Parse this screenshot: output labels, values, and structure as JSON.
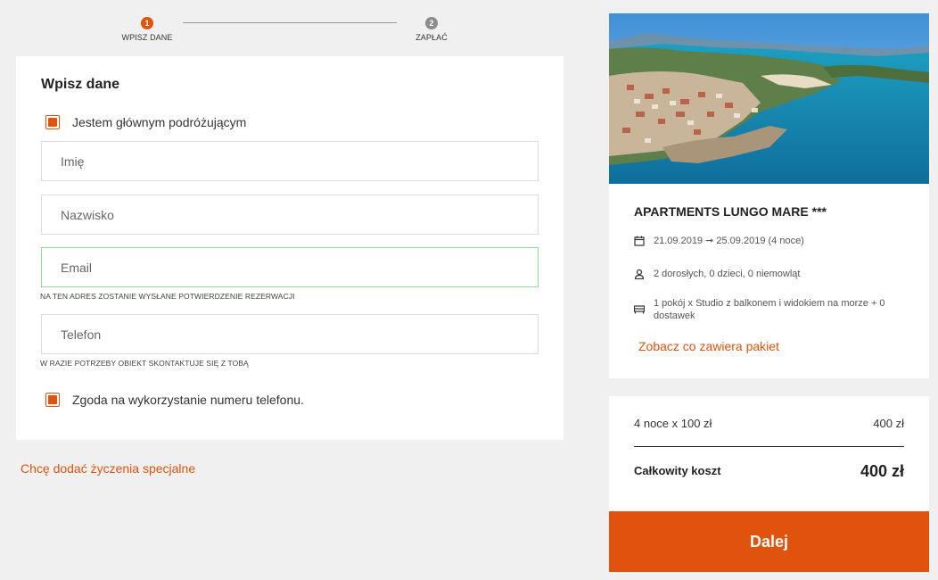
{
  "colors": {
    "accent": "#e0530c",
    "step_active": "#e0530c",
    "step_inactive": "#8c8c8c",
    "focus_border": "#9ad89a",
    "background": "#f0f0f0"
  },
  "stepper": {
    "steps": [
      {
        "number": "1",
        "label": "WPISZ DANE",
        "active": true
      },
      {
        "number": "2",
        "label": "ZAPŁAĆ",
        "active": false
      }
    ]
  },
  "form": {
    "title": "Wpisz dane",
    "main_traveler_label": "Jestem głównym podróżującym",
    "main_traveler_checked": true,
    "first_name": {
      "placeholder": "Imię",
      "value": ""
    },
    "last_name": {
      "placeholder": "Nazwisko",
      "value": ""
    },
    "email": {
      "placeholder": "Email",
      "value": "",
      "hint": "NA TEN ADRES ZOSTANIE WYSŁANE POTWIERDZENIE REZERWACJI"
    },
    "phone": {
      "placeholder": "Telefon",
      "value": "",
      "hint": "W RAZIE POTRZEBY OBIEKT SKONTAKTUJE SIĘ Z TOBĄ"
    },
    "phone_consent_label": "Zgoda na wykorzystanie numeru telefonu.",
    "phone_consent_checked": true
  },
  "special_requests_link": "Chcę dodać życzenia specjalne",
  "hotel": {
    "name": "APARTMENTS LUNGO MARE ***",
    "dates": "21.09.2019 ➞ 25.09.2019 (4 noce)",
    "guests": "2 dorosłych, 0 dzieci, 0 niemowląt",
    "room": "1 pokój x Studio z balkonem i widokiem na morze + 0 dostawek",
    "package_link": "Zobacz co zawiera pakiet",
    "icons": {
      "dates": "calendar-icon",
      "guests": "person-icon",
      "room": "bed-icon"
    }
  },
  "price": {
    "line_label": "4 noce x 100 zł",
    "line_value": "400 zł",
    "total_label": "Całkowity koszt",
    "total_value": "400 zł",
    "next_button": "Dalej"
  }
}
